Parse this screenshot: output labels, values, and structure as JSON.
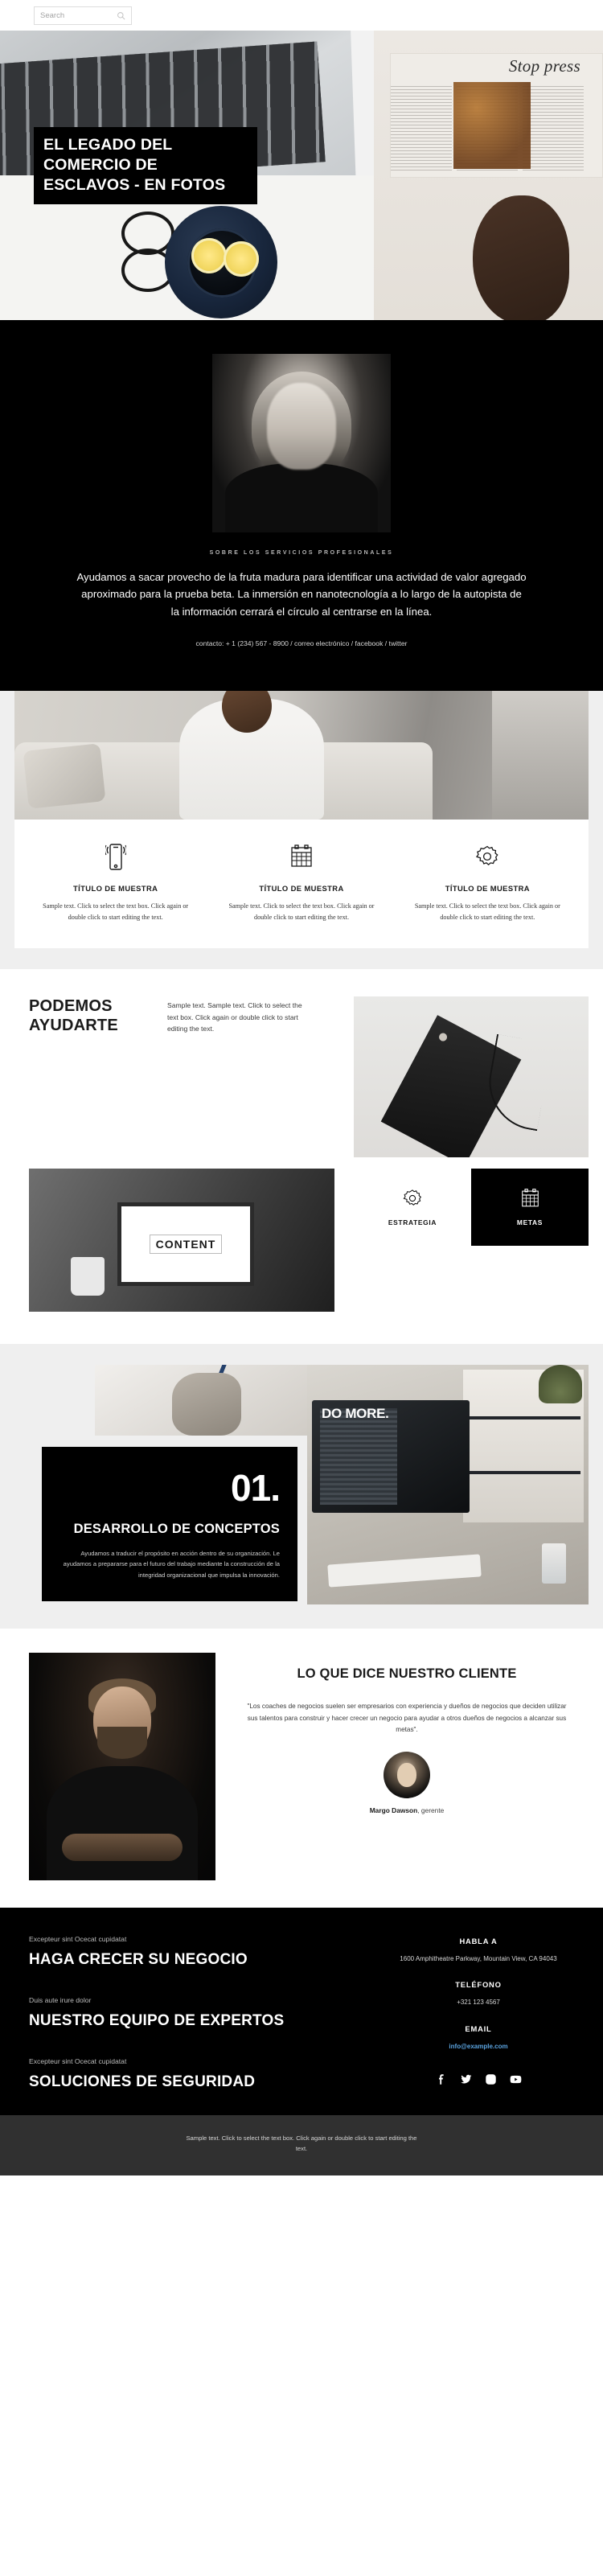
{
  "search": {
    "placeholder": "Search",
    "value": "",
    "icon": "search-icon"
  },
  "hero": {
    "title": "EL LEGADO DEL COMERCIO DE ESCLAVOS - EN FOTOS",
    "magazine_text": "Stop press"
  },
  "about": {
    "eyebrow": "SOBRE LOS SERVICIOS PROFESIONALES",
    "lead": "Ayudamos a sacar provecho de la fruta madura para identificar una actividad de valor agregado aproximado para la prueba beta. La inmersión en nanotecnología a lo largo de la autopista de la información cerrará el círculo al centrarse en la línea.",
    "contact": "contacto: + 1 (234) 567 - 8900 / correo electrónico / facebook / twitter"
  },
  "features": [
    {
      "icon": "mobile-phone-icon",
      "title": "TÍTULO DE MUESTRA",
      "text": "Sample text. Click to select the text box. Click again or double click to start editing the text."
    },
    {
      "icon": "calendar-icon",
      "title": "TÍTULO DE MUESTRA",
      "text": "Sample text. Click to select the text box. Click again or double click to start editing the text."
    },
    {
      "icon": "gear-icon",
      "title": "TÍTULO DE MUESTRA",
      "text": "Sample text. Click to select the text box. Click again or double click to start editing the text."
    }
  ],
  "help": {
    "title": "PODEMOS AYUDARTE",
    "text": "Sample text. Sample text. Click to select the text box. Click again or double click to start editing the text.",
    "laptop_screen_label": "CONTENT",
    "kpis": [
      {
        "icon": "gear-icon",
        "label": "ESTRATEGIA",
        "theme": "light"
      },
      {
        "icon": "calendar-icon",
        "label": "METAS",
        "theme": "dark"
      }
    ]
  },
  "concepts": {
    "number": "01.",
    "title": "DESARROLLO DE CONCEPTOS",
    "text": "Ayudamos a traducir el propósito en acción dentro de su organización. Le ayudamos a prepararse para el futuro del trabajo mediante la construcción de la integridad organizacional que impulsa la innovación.",
    "monitor_text": "DO MORE."
  },
  "testimonial": {
    "heading": "LO QUE DICE NUESTRO CLIENTE",
    "quote": "\"Los coaches de negocios suelen ser empresarios con experiencia y dueños de negocios que deciden utilizar sus talentos para construir y hacer crecer un negocio para ayudar a otros dueños de negocios a alcanzar sus metas\".",
    "author_name": "Margo Dawson",
    "author_role": ", gerente"
  },
  "footer": {
    "blocks": [
      {
        "kicker": "Excepteur sint Ocecat cupidatat",
        "heading": "HAGA CRECER SU NEGOCIO"
      },
      {
        "kicker": "Duis aute irure dolor",
        "heading": "NUESTRO EQUIPO DE EXPERTOS"
      },
      {
        "kicker": "Excepteur sint Ocecat cupidatat",
        "heading": "SOLUCIONES DE SEGURIDAD"
      }
    ],
    "contact": {
      "address_label": "HABLA A",
      "address_value": "1600 Amphitheatre Parkway, Mountain View, CA 94043",
      "phone_label": "TELÉFONO",
      "phone_value": "+321 123 4567",
      "email_label": "EMAIL",
      "email_value": "info@example.com",
      "email_color": "#5ba4e0"
    },
    "socials": [
      {
        "name": "facebook-icon"
      },
      {
        "name": "twitter-icon"
      },
      {
        "name": "instagram-icon"
      },
      {
        "name": "youtube-icon"
      }
    ],
    "bottom_text": "Sample text. Click to select the text box. Click again or double click to start editing the text."
  }
}
